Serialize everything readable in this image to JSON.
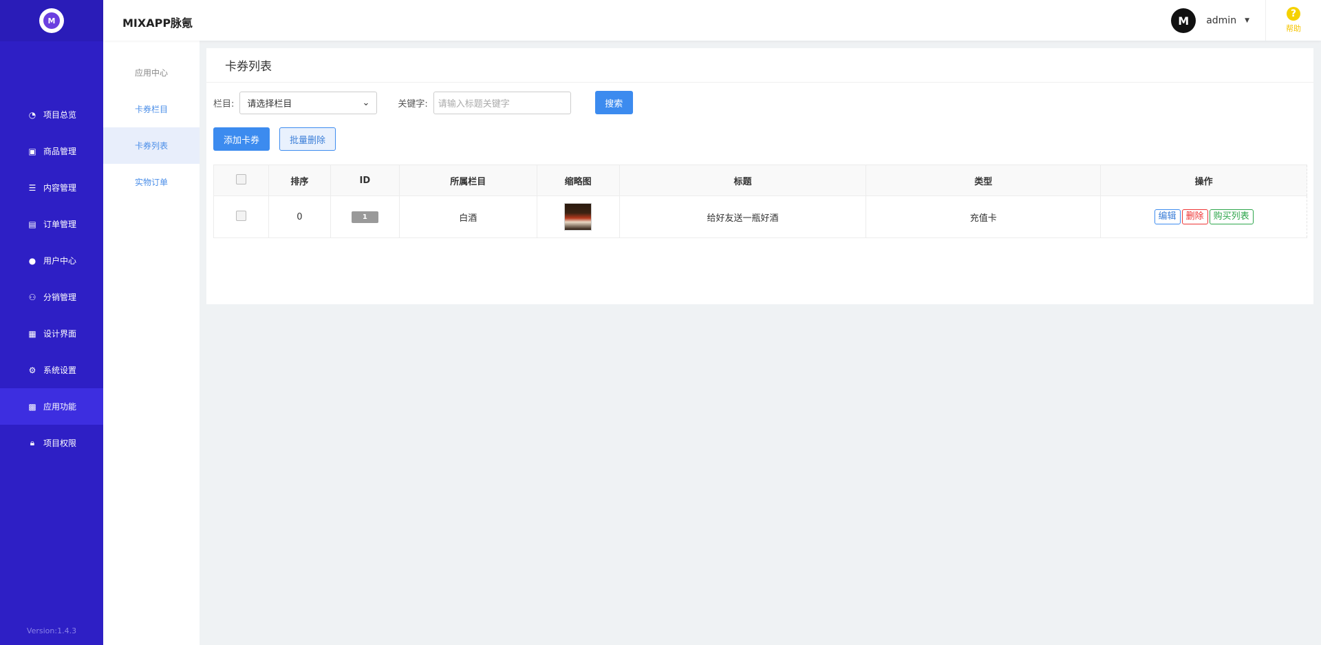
{
  "header": {
    "app_name": "MIXAPP脉氪",
    "user_name": "admin",
    "help_label": "帮助"
  },
  "sidebar": {
    "logo_text": "M",
    "items": [
      {
        "label": "项目总览",
        "icon": "pie-chart-icon"
      },
      {
        "label": "商品管理",
        "icon": "product-icon"
      },
      {
        "label": "内容管理",
        "icon": "list-icon"
      },
      {
        "label": "订单管理",
        "icon": "order-icon"
      },
      {
        "label": "用户中心",
        "icon": "user-icon"
      },
      {
        "label": "分销管理",
        "icon": "users-icon"
      },
      {
        "label": "设计界面",
        "icon": "layout-icon"
      },
      {
        "label": "系统设置",
        "icon": "gear-icon"
      },
      {
        "label": "应用功能",
        "icon": "grid-icon",
        "active": true
      },
      {
        "label": "项目权限",
        "icon": "lock-icon"
      }
    ],
    "version": "Version:1.4.3"
  },
  "subnav": {
    "items": [
      {
        "label": "应用中心"
      },
      {
        "label": "卡券栏目"
      },
      {
        "label": "卡券列表",
        "active": true
      },
      {
        "label": "实物订单"
      }
    ]
  },
  "main": {
    "title": "卡券列表",
    "filter": {
      "category_label": "栏目:",
      "category_value": "请选择栏目",
      "keyword_label": "关键字:",
      "keyword_placeholder": "请输入标题关键字",
      "search_label": "搜索"
    },
    "add_label": "添加卡券",
    "batch_delete_label": "批量删除",
    "table": {
      "headers": [
        "排序",
        "ID",
        "所属栏目",
        "缩略图",
        "标题",
        "类型",
        "操作"
      ],
      "rows": [
        {
          "sort": "0",
          "id": "1",
          "category": "白酒",
          "title": "给好友送一瓶好酒",
          "type": "充值卡",
          "ops": [
            "编辑",
            "删除",
            "购买列表"
          ]
        }
      ]
    }
  },
  "colors": {
    "sidebar": "#2e1fc5",
    "primary": "#3c8bef",
    "danger": "#e33",
    "success": "#2ca54a"
  }
}
